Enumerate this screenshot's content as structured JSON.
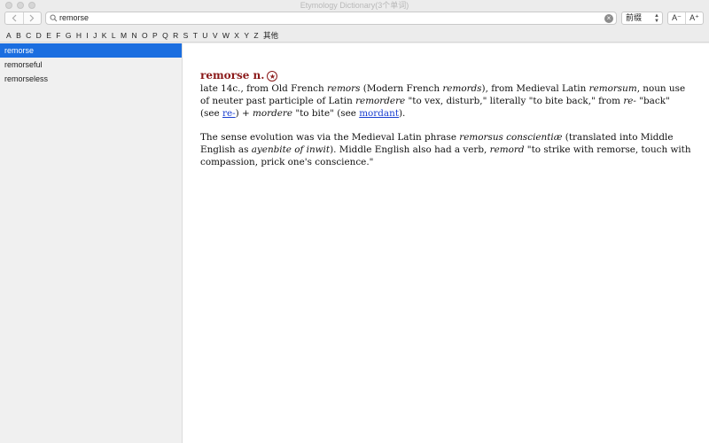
{
  "window": {
    "title": "Etymology Dictionary(3个单词)"
  },
  "toolbar": {
    "search_value": "remorse",
    "dropdown_value": "前缀",
    "font_decrease": "A⁻",
    "font_increase": "A⁺"
  },
  "alphabet": [
    "A",
    "B",
    "C",
    "D",
    "E",
    "F",
    "G",
    "H",
    "I",
    "J",
    "K",
    "L",
    "M",
    "N",
    "O",
    "P",
    "Q",
    "R",
    "S",
    "T",
    "U",
    "V",
    "W",
    "X",
    "Y",
    "Z",
    "其他"
  ],
  "sidebar": {
    "items": [
      {
        "label": "remorse",
        "selected": true
      },
      {
        "label": "remorseful",
        "selected": false
      },
      {
        "label": "remorseless",
        "selected": false
      }
    ]
  },
  "entry": {
    "headword": "remorse n.",
    "p1": {
      "t1": "late 14c., from Old French ",
      "i1": "remors",
      "t2": " (Modern French ",
      "i2": "remords",
      "t3": "), from Medieval Latin ",
      "i3": "remorsum",
      "t4": ", noun use of neuter past participle of Latin ",
      "i4": "remordere",
      "t5": " \"to vex, disturb,\" literally \"to bite back,\" from ",
      "i5": "re-",
      "t6": " \"back\" (see ",
      "link1": "re-",
      "t7": ") + ",
      "i6": "mordere",
      "t8": " \"to bite\" (see ",
      "link2": "mordant",
      "t9": ")."
    },
    "p2": {
      "t1": "The sense evolution was via the Medieval Latin phrase ",
      "i1": "remorsus conscientiæ",
      "t2": " (translated into Middle English as ",
      "i2": "ayenbite of inwit",
      "t3": "). Middle English also had a verb, ",
      "i3": "remord",
      "t4": " \"to strike with remorse, touch with compassion, prick one's conscience.\""
    }
  }
}
